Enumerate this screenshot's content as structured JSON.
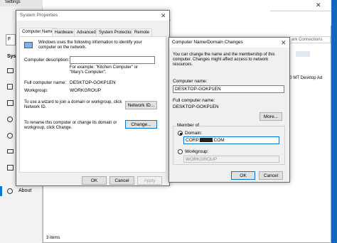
{
  "settings": {
    "title": "Settings",
    "sidebar_label_partial": "Syst",
    "search_partial": "F",
    "about_label": "About"
  },
  "explorer": {
    "search_partial": "ark Connections",
    "item_partial": "00 MT Desktop Ad",
    "status": "3 items"
  },
  "system_properties": {
    "title": "System Properties",
    "tabs": [
      "Computer Name",
      "Hardware",
      "Advanced",
      "System Protection",
      "Remote"
    ],
    "intro": "Windows uses the following information to identify your computer on the network.",
    "description_label": "Computer description:",
    "description_value": "",
    "example": "For example: \"Kitchen Computer\" or \"Mary's Computer\".",
    "full_name_label": "Full computer name:",
    "full_name_value": "DESKTOP-GOKP1EN",
    "workgroup_label": "Workgroup:",
    "workgroup_value": "WORKGROUP",
    "wizard_text": "To use a wizard to join a domain or workgroup, click Network ID.",
    "network_id_label": "Network ID...",
    "rename_text": "To rename this computer or change its domain or workgroup, click Change.",
    "change_label": "Change...",
    "ok_label": "OK",
    "cancel_label": "Cancel",
    "apply_label": "Apply"
  },
  "domain_changes": {
    "title": "Computer Name/Domain Changes",
    "intro": "You can change the name and the membership of this computer. Changes might affect access to network resources.",
    "computer_name_label": "Computer name:",
    "computer_name_value": "DESKTOP-GOKP1EN",
    "full_name_label": "Full computer name:",
    "full_name_value": "DESKTOP-GOKP1EN",
    "more_label": "More...",
    "member_of_label": "Member of",
    "domain_label": "Domain:",
    "domain_value_prefix": "CORP.",
    "domain_value_suffix": ".COM",
    "workgroup_label": "Workgroup:",
    "workgroup_value": "WORKGROUP",
    "ok_label": "OK",
    "cancel_label": "Cancel"
  },
  "colors": {
    "accent": "#0078d7",
    "dialog_bg": "#f0f0f0",
    "taskbar_blue": "#1565c0"
  }
}
